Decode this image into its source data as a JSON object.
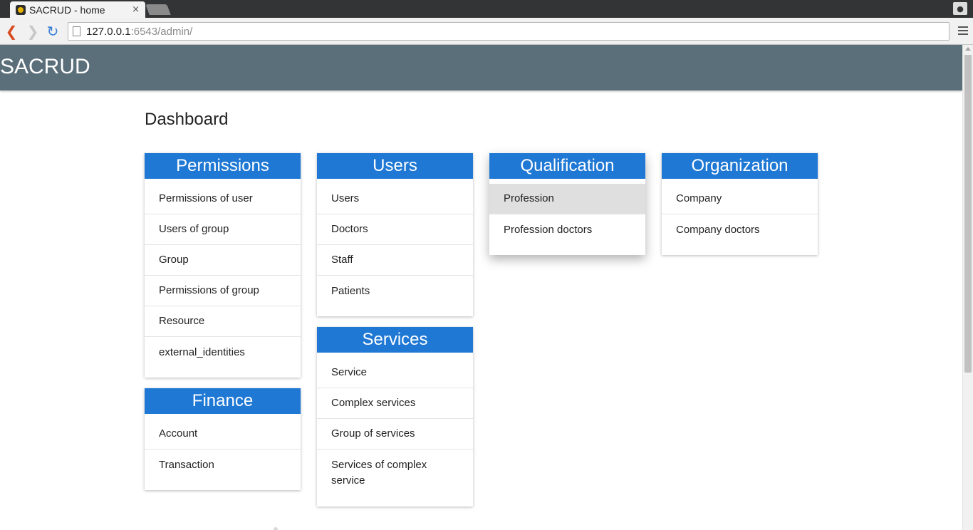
{
  "browser": {
    "tab_title": "SACRUD - home",
    "tab_close": "×",
    "url_host": "127.0.0.1",
    "url_rest": ":6543/admin/"
  },
  "app": {
    "brand": "SACRUD",
    "page_title": "Dashboard"
  },
  "cards": {
    "permissions": {
      "title": "Permissions",
      "items": [
        "Permissions of user",
        "Users of group",
        "Group",
        "Permissions of group",
        "Resource",
        "external_identities"
      ]
    },
    "finance": {
      "title": "Finance",
      "items": [
        "Account",
        "Transaction"
      ]
    },
    "users": {
      "title": "Users",
      "items": [
        "Users",
        "Doctors",
        "Staff",
        "Patients"
      ]
    },
    "services": {
      "title": "Services",
      "items": [
        "Service",
        "Complex services",
        "Group of services",
        "Services of complex service"
      ]
    },
    "qualification": {
      "title": "Qualification",
      "items": [
        "Profession",
        "Profession doctors"
      ],
      "active_item": "Profession"
    },
    "organization": {
      "title": "Organization",
      "items": [
        "Company",
        "Company doctors"
      ]
    }
  },
  "colors": {
    "header_bg": "#5a6f7a",
    "card_header_bg": "#1e78d4",
    "active_item_bg": "#dfdfdf"
  }
}
